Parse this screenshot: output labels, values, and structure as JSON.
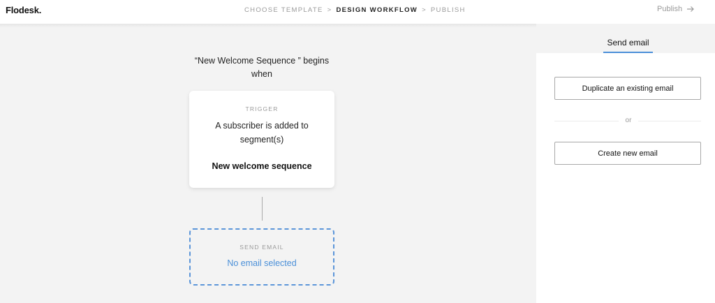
{
  "header": {
    "logo": "Flodesk.",
    "steps": [
      {
        "label": "CHOOSE TEMPLATE"
      },
      {
        "label": "DESIGN WORKFLOW"
      },
      {
        "label": "PUBLISH"
      }
    ],
    "step_separator": ">",
    "active_step": "DESIGN WORKFLOW",
    "publish_label": "Publish",
    "publish_icon": "arrow-right-icon"
  },
  "workflow": {
    "begins_text": "“New Welcome Sequence ” begins when",
    "trigger": {
      "tag": "TRIGGER",
      "description": "A subscriber is added to segment(s)",
      "segment": "New welcome sequence"
    },
    "send_email": {
      "tag": "SEND EMAIL",
      "status": "No email selected"
    }
  },
  "panel": {
    "tab_label": "Send email",
    "duplicate_button": "Duplicate an existing email",
    "or_label": "or",
    "create_button": "Create new email"
  },
  "colors": {
    "accent": "#4a8fd8",
    "canvas_bg": "#f3f3f3",
    "muted_text": "#9a9a9a"
  }
}
